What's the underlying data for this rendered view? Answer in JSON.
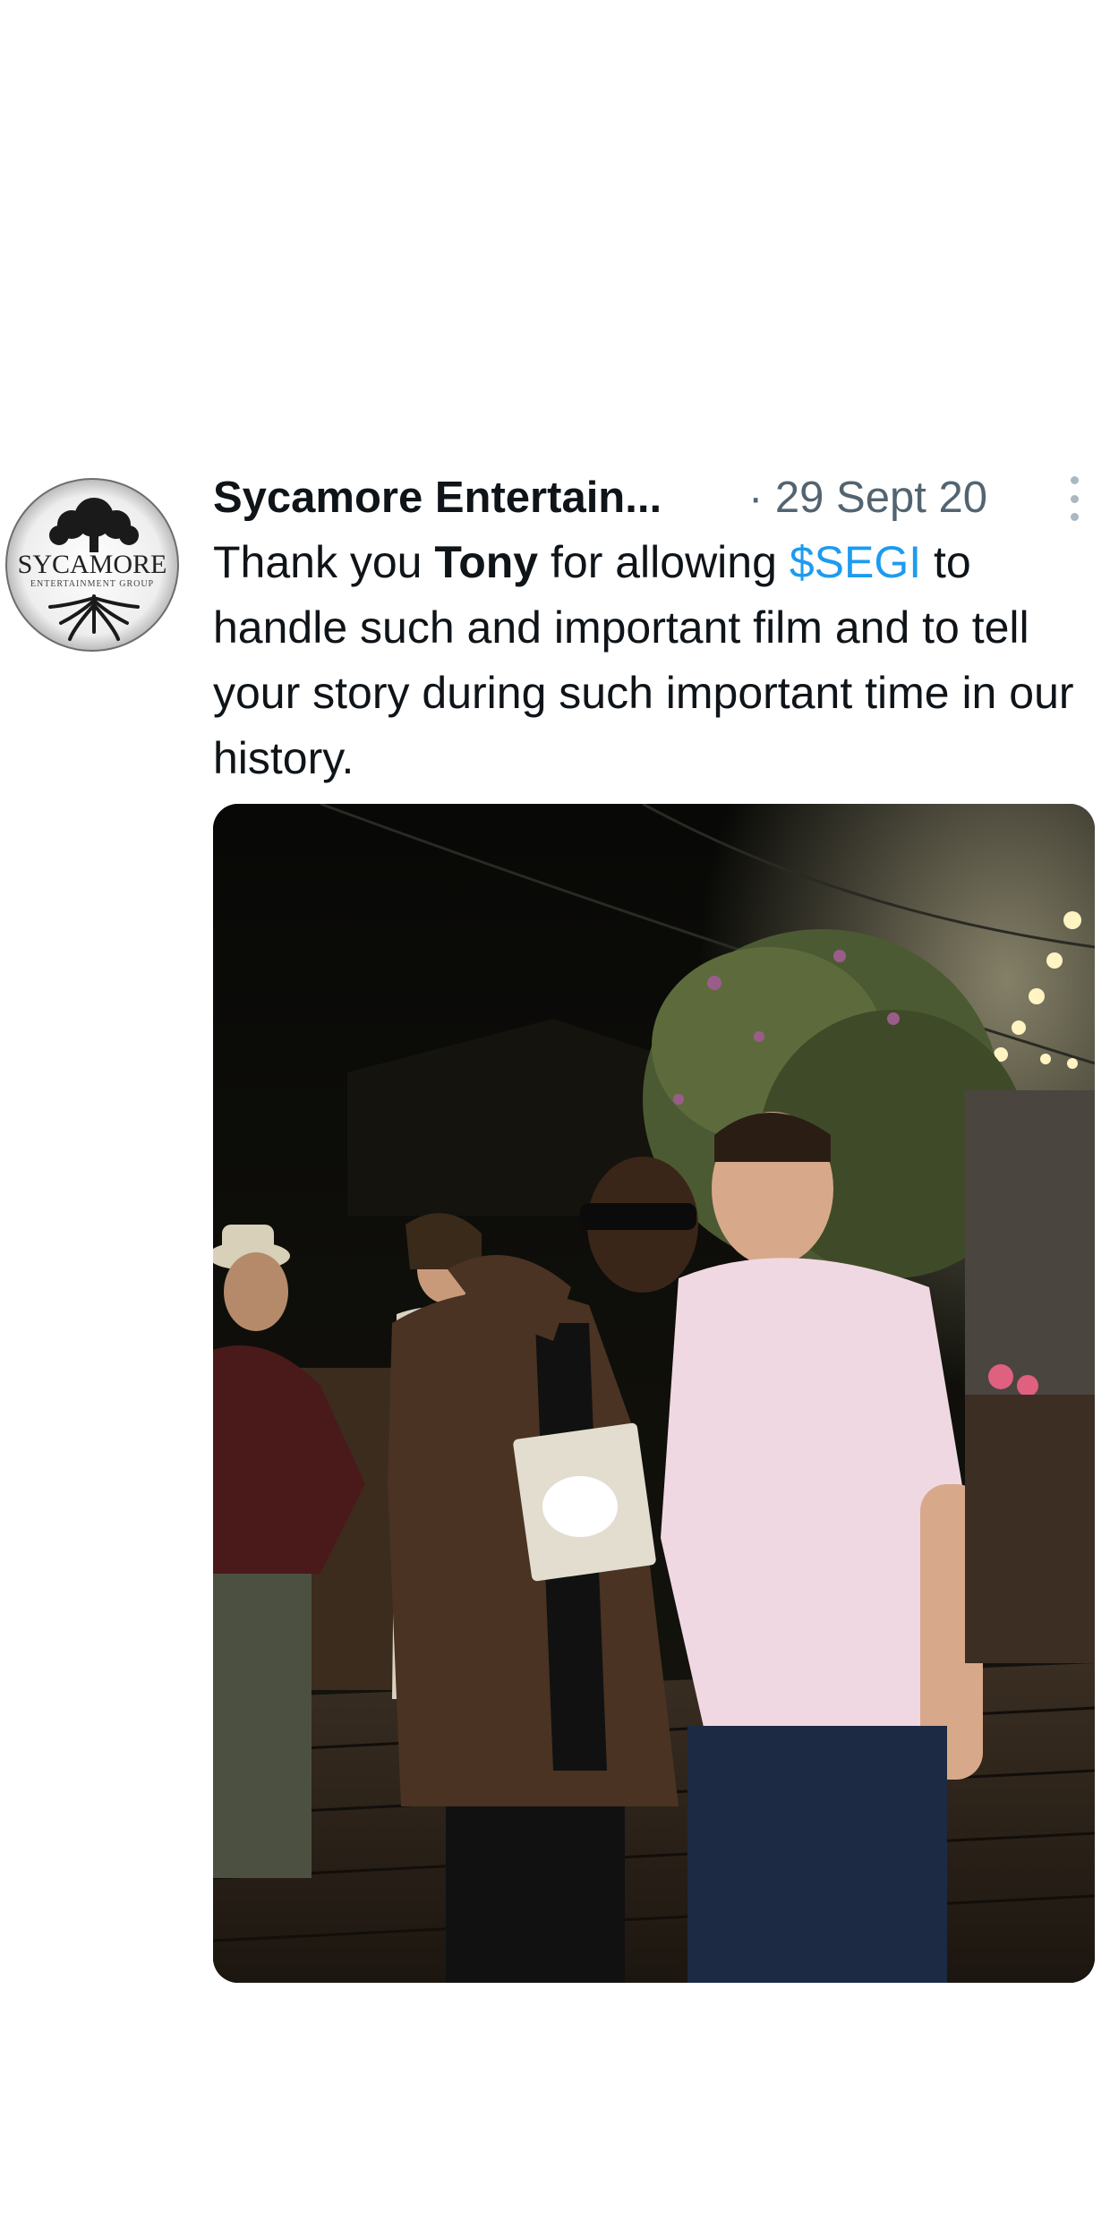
{
  "tweet": {
    "display_name": "Sycamore Entertain...",
    "date": "· 29 Sept 20",
    "avatar": {
      "logo_word": "SYCAMORE",
      "logo_sub": "ENTERTAINMENT GROUP"
    },
    "text": {
      "part1": "Thank you ",
      "mention_bold": "Tony",
      "part2": " for allowing ",
      "cashtag": "$SEGI",
      "part3": " to handle such and important film and to tell your story during such important time in our history."
    },
    "colors": {
      "cashtag": "#1d9bf0",
      "secondary_text": "#536471"
    },
    "icons": [
      "more-options-icon"
    ]
  }
}
